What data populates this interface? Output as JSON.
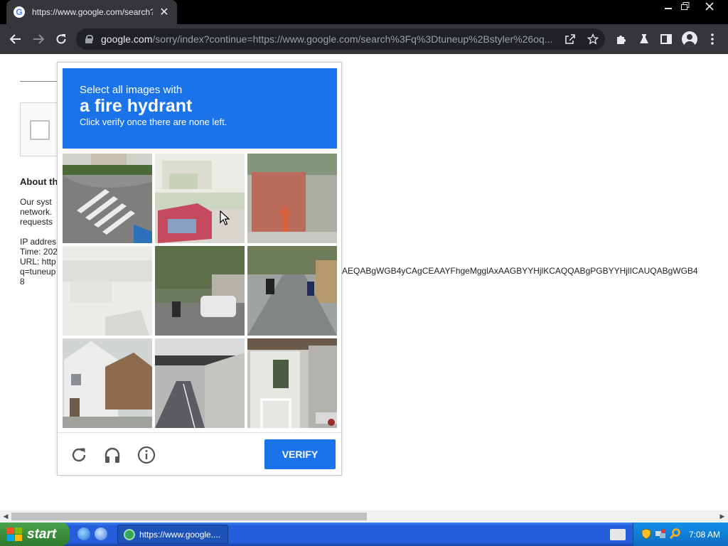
{
  "browser": {
    "tab_title": "https://www.google.com/search?q",
    "favicon_letter": "G",
    "url_host": "google.com",
    "url_path": "/sorry/index?continue=https://www.google.com/search%3Fq%3Dtuneup%2Bstyler%26oq..."
  },
  "page": {
    "about_title": "About th",
    "para1": [
      "Our syst",
      "network.",
      "requests"
    ],
    "ip_label": "IP addres",
    "time_label": "Time: 202",
    "url_label": "URL: http",
    "q_label": "q=tuneup",
    "eight": "8",
    "long_url_fragment": "AEQABgWGB4yCAgCEAAYFhgeMgglAxAAGBYYHjlKCAQQABgPGBYYHjlICAUQABgWGB4"
  },
  "captcha": {
    "instruction_line1": "Select all images with",
    "target_object": "a fire hydrant",
    "instruction_line3": "Click verify once there are none left.",
    "verify_label": "VERIFY",
    "tile_colors": {
      "blue": "#1a73e8"
    }
  },
  "taskbar": {
    "start_label": "start",
    "task_label": "https://www.google....",
    "clock": "7:08 AM"
  }
}
